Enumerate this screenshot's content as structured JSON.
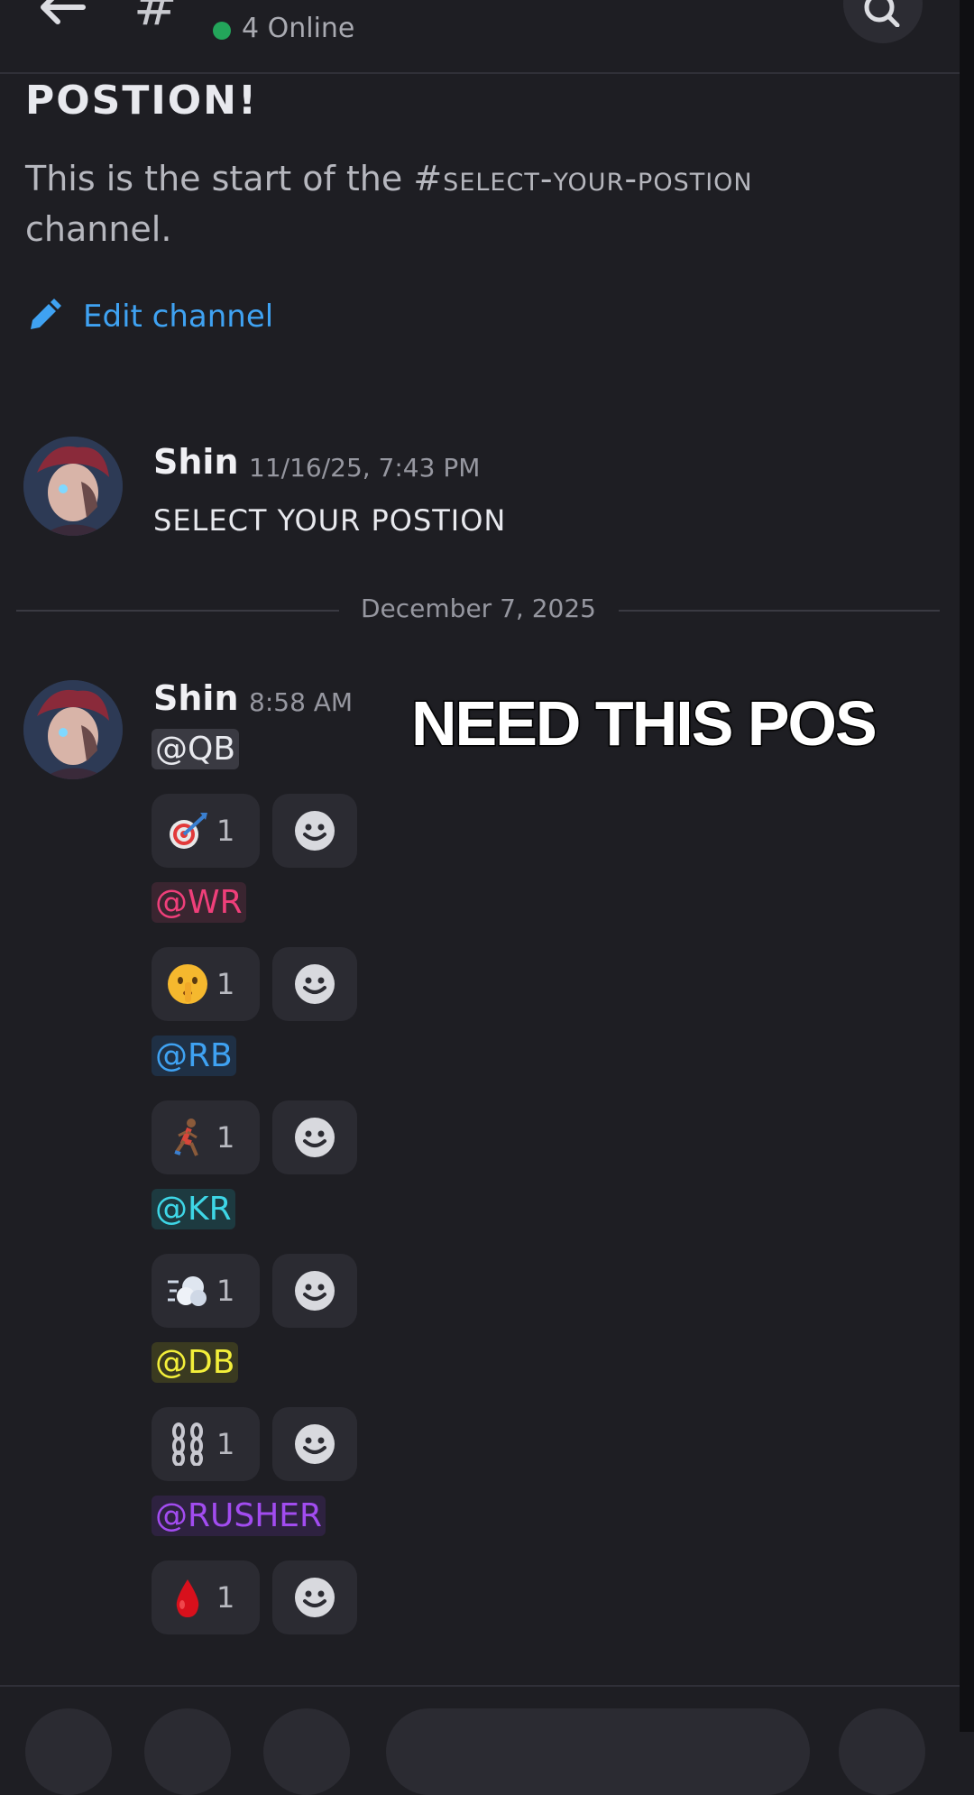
{
  "header": {
    "online": "4 Online"
  },
  "channel": {
    "title": "POSTION!",
    "desc_prefix": "This is the start of the ",
    "desc_channel": "#select-your-postion",
    "desc_suffix": " channel.",
    "edit_label": "Edit channel"
  },
  "messages": [
    {
      "author": "Shin",
      "timestamp": "11/16/25, 7:43 PM",
      "text": "SELECT YOUR POSTION"
    },
    {
      "author": "Shin",
      "timestamp": "8:58 AM"
    }
  ],
  "date_divider": "December 7, 2025",
  "roles": [
    {
      "mention": "@QB",
      "color": "#e8e9ee",
      "bg": "#3a3a42",
      "emoji": "dart-icon",
      "count": "1"
    },
    {
      "mention": "@WR",
      "color": "#ef3f7a",
      "bg": "#3a2530",
      "emoji": "shushing-face-icon",
      "count": "1"
    },
    {
      "mention": "@RB",
      "color": "#3fa2f2",
      "bg": "#1f3045",
      "emoji": "runner-icon",
      "count": "1"
    },
    {
      "mention": "@KR",
      "color": "#3ed6e6",
      "bg": "#1d3a40",
      "emoji": "dash-icon",
      "count": "1"
    },
    {
      "mention": "@DB",
      "color": "#f3ef3a",
      "bg": "#3a3a20",
      "emoji": "chains-icon",
      "count": "1"
    },
    {
      "mention": "@RUSHER",
      "color": "#a24cf0",
      "bg": "#2e2240",
      "emoji": "drop-of-blood-icon",
      "count": "1"
    }
  ],
  "overlay_caption": "NEED THIS POS"
}
